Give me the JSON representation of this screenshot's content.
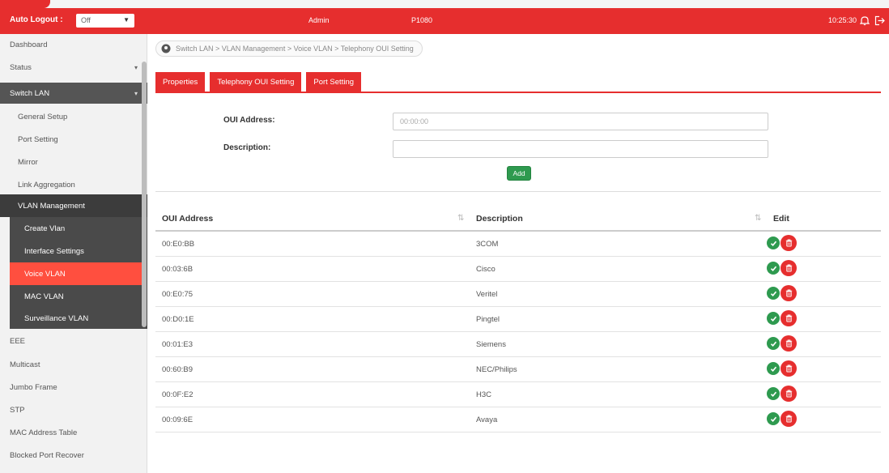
{
  "header": {
    "auto_logout_label": "Auto Logout :",
    "auto_logout_value": "Off",
    "user": "Admin",
    "model": "P1080",
    "time": "10:25:30"
  },
  "sidebar": {
    "items": [
      {
        "label": "Dashboard"
      },
      {
        "label": "Status"
      },
      {
        "label": "Switch LAN"
      },
      {
        "label": "General Setup"
      },
      {
        "label": "Port Setting"
      },
      {
        "label": "Mirror"
      },
      {
        "label": "Link Aggregation"
      },
      {
        "label": "VLAN Management"
      },
      {
        "label": "Create Vlan"
      },
      {
        "label": "Interface Settings"
      },
      {
        "label": "Voice VLAN"
      },
      {
        "label": "MAC VLAN"
      },
      {
        "label": "Surveillance VLAN"
      },
      {
        "label": "EEE"
      },
      {
        "label": "Multicast"
      },
      {
        "label": "Jumbo Frame"
      },
      {
        "label": "STP"
      },
      {
        "label": "MAC Address Table"
      },
      {
        "label": "Blocked Port Recover"
      }
    ]
  },
  "breadcrumb": {
    "text": "Switch LAN > VLAN Management > Voice VLAN > Telephony OUI Setting"
  },
  "tabs": [
    {
      "label": "Properties"
    },
    {
      "label": "Telephony OUI Setting"
    },
    {
      "label": "Port Setting"
    }
  ],
  "form": {
    "oui_label": "OUI Address:",
    "oui_placeholder": "00:00:00",
    "oui_value": "",
    "desc_label": "Description:",
    "desc_value": "",
    "add_label": "Add"
  },
  "table": {
    "headers": {
      "oui": "OUI Address",
      "description": "Description",
      "edit": "Edit"
    },
    "rows": [
      {
        "oui": "00:E0:BB",
        "description": "3COM"
      },
      {
        "oui": "00:03:6B",
        "description": "Cisco"
      },
      {
        "oui": "00:E0:75",
        "description": "Veritel"
      },
      {
        "oui": "00:D0:1E",
        "description": "Pingtel"
      },
      {
        "oui": "00:01:E3",
        "description": "Siemens"
      },
      {
        "oui": "00:60:B9",
        "description": "NEC/Philips"
      },
      {
        "oui": "00:0F:E2",
        "description": "H3C"
      },
      {
        "oui": "00:09:6E",
        "description": "Avaya"
      }
    ]
  },
  "colors": {
    "brand_red": "#e62e2e",
    "active_item": "#ff4f3f",
    "success_green": "#2e9a4f"
  },
  "icons": [
    "bell-icon",
    "logout-icon",
    "pin-icon",
    "check-icon",
    "trash-icon",
    "chevron-down-icon",
    "sort-icon"
  ]
}
